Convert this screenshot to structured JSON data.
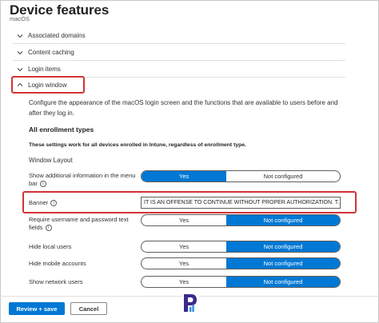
{
  "header": {
    "title": "Device features",
    "more_icon": "ellipsis-icon",
    "subtitle": "macOS"
  },
  "sections": [
    {
      "label": "Associated domains",
      "expanded": false
    },
    {
      "label": "Content caching",
      "expanded": false
    },
    {
      "label": "Login items",
      "expanded": false
    },
    {
      "label": "Login window",
      "expanded": true
    }
  ],
  "login_window": {
    "description": "Configure the appearance of the macOS login screen and the functions that are available to users before and after they log in.",
    "group_heading": "All enrollment types",
    "group_note": "These settings work for all devices enrolled in Intune, regardless of enrollment type.",
    "subheading": "Window Layout",
    "settings": [
      {
        "label": "Show additional information in the menu bar",
        "info": true,
        "options": [
          "Yes",
          "Not configured"
        ],
        "selected": "Yes"
      },
      {
        "label": "Banner",
        "info": true,
        "value": "IT IS AN OFFENSE TO CONTINUE WITHOUT PROPER AUTHORIZATION. T..."
      },
      {
        "label": "Require username and password text fields",
        "info": true,
        "options": [
          "Yes",
          "Not configured"
        ],
        "selected": "Not configured"
      },
      {
        "label": "Hide local users",
        "info": false,
        "options": [
          "Yes",
          "Not configured"
        ],
        "selected": "Not configured"
      },
      {
        "label": "Hide mobile accounts",
        "info": false,
        "options": [
          "Yes",
          "Not configured"
        ],
        "selected": "Not configured"
      },
      {
        "label": "Show network users",
        "info": false,
        "options": [
          "Yes",
          "Not configured"
        ],
        "selected": "Not configured"
      }
    ]
  },
  "footer": {
    "primary_label": "Review + save",
    "secondary_label": "Cancel"
  },
  "colors": {
    "accent": "#0078d4",
    "highlight": "#d13438"
  }
}
